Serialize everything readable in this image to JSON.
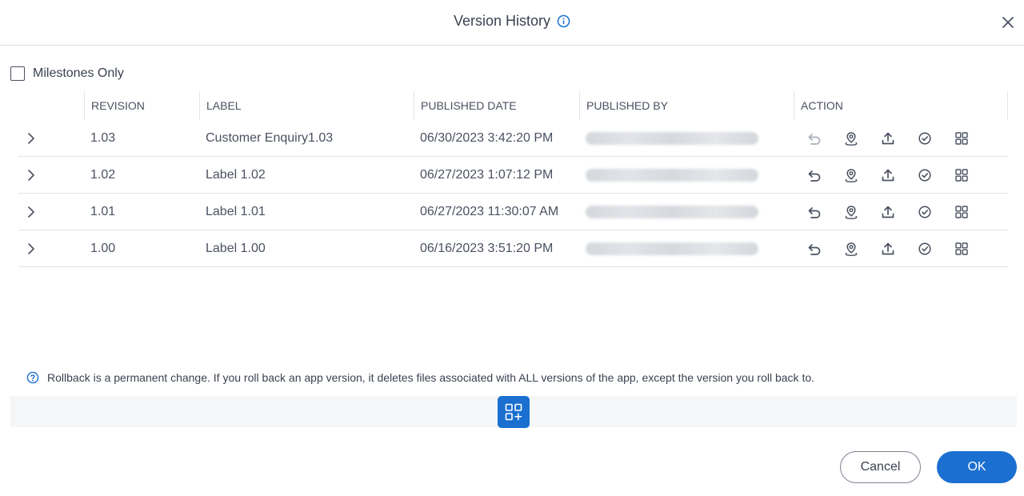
{
  "dialog": {
    "title": "Version History",
    "info_icon": "info-icon",
    "close_icon": "close-icon"
  },
  "filter": {
    "milestones_label": "Milestones Only",
    "milestones_checked": false
  },
  "table": {
    "columns": [
      "REVISION",
      "LABEL",
      "PUBLISHED DATE",
      "PUBLISHED BY",
      "ACTION"
    ],
    "rows": [
      {
        "revision": "1.03",
        "label": "Customer Enquiry1.03",
        "published_date": "06/30/2023 3:42:20 PM",
        "rollback_enabled": false
      },
      {
        "revision": "1.02",
        "label": "Label 1.02",
        "published_date": "06/27/2023 1:07:12 PM",
        "rollback_enabled": true
      },
      {
        "revision": "1.01",
        "label": "Label 1.01",
        "published_date": "06/27/2023 11:30:07 AM",
        "rollback_enabled": true
      },
      {
        "revision": "1.00",
        "label": "Label 1.00",
        "published_date": "06/16/2023 3:51:20 PM",
        "rollback_enabled": true
      }
    ],
    "action_icons": [
      "rollback-icon",
      "milestone-pin-icon",
      "upload-icon",
      "check-circle-icon",
      "grid-icon"
    ]
  },
  "note": {
    "icon": "help-circle-icon",
    "text": "Rollback is a permanent change. If you roll back an app version, it deletes files associated with ALL versions of the app, except the version you roll back to."
  },
  "toolbar": {
    "add_widget_icon": "add-widget-icon"
  },
  "footer": {
    "cancel_label": "Cancel",
    "ok_label": "OK"
  },
  "colors": {
    "accent": "#1a6fd0",
    "text": "#3a4250",
    "border": "#e2e5ea",
    "disabled_icon": "#a9aeb6"
  }
}
